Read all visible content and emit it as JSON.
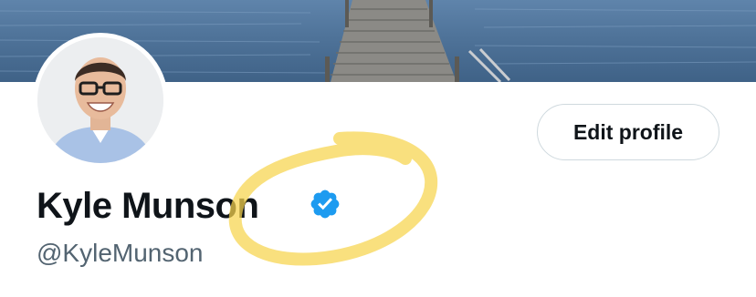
{
  "profile": {
    "display_name": "Kyle Munson",
    "handle": "@KyleMunson",
    "verified_icon": "verified-badge-icon",
    "avatar": "profile-photo",
    "banner": "lake-dock-banner"
  },
  "actions": {
    "edit_profile_label": "Edit profile"
  },
  "colors": {
    "verified_blue": "#1d9bf0",
    "name_text": "#0f1419",
    "handle_text": "#536471",
    "highlight_yellow": "#f7d44c"
  }
}
